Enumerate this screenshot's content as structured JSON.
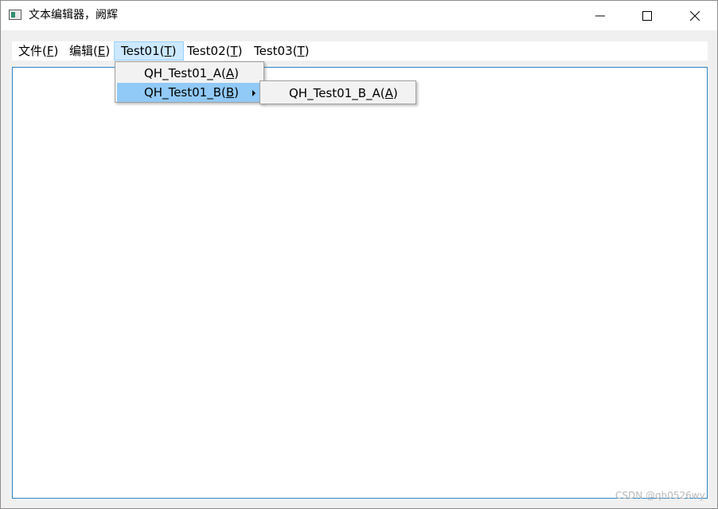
{
  "window": {
    "title": "文本编辑器，阙辉"
  },
  "menubar": {
    "items": [
      {
        "pre": "文件(",
        "key": "F",
        "post": ")"
      },
      {
        "pre": "编辑(",
        "key": "E",
        "post": ")"
      },
      {
        "pre": "Test01(",
        "key": "T",
        "post": ")"
      },
      {
        "pre": "Test02(",
        "key": "T",
        "post": ")"
      },
      {
        "pre": "Test03(",
        "key": "T",
        "post": ")"
      }
    ]
  },
  "dropdown": {
    "items": [
      {
        "pre": "QH_Test01_A(",
        "key": "A",
        "post": ")"
      },
      {
        "pre": "QH_Test01_B(",
        "key": "B",
        "post": ")"
      }
    ]
  },
  "submenu": {
    "items": [
      {
        "pre": "QH_Test01_B_A(",
        "key": "A",
        "post": ")"
      }
    ]
  },
  "watermark": "CSDN @qh0526wy",
  "colors": {
    "menu_active": "#cce8ff",
    "menu_item_highlight": "#91c9f7",
    "editor_border": "#2c86c6"
  }
}
